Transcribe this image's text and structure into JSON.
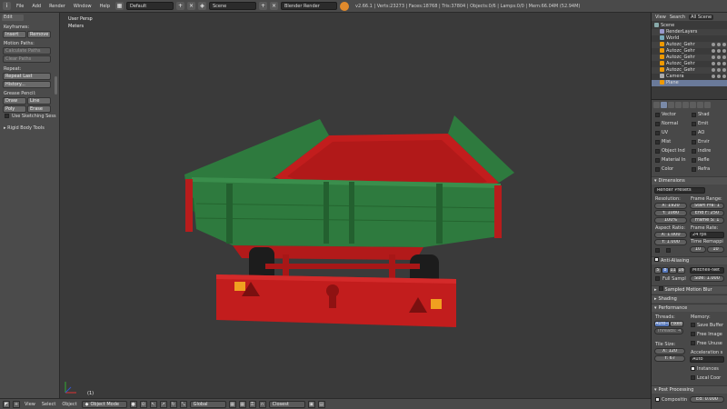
{
  "topbar": {
    "menus": [
      "File",
      "Add",
      "Render",
      "Window",
      "Help"
    ],
    "screen_layout": "Default",
    "scene": "Scene",
    "engine": "Blender Render",
    "stats": "v2.66.1 | Verts:23273 | Faces:18768 | Tris:37804 | Objects:0/6 | Lamps:0/0 | Mem:66.04M (52.94M)"
  },
  "toolshelf": {
    "tab": "Edit",
    "keyframes": {
      "title": "Keyframes:",
      "insert": "Insert",
      "remove": "Remove"
    },
    "motion_paths": {
      "title": "Motion Paths:",
      "calculate": "Calculate Paths",
      "clear": "Clear Paths"
    },
    "repeat": {
      "title": "Repeat:",
      "repeat_last": "Repeat Last",
      "history": "History..."
    },
    "grease_pencil": {
      "title": "Grease Pencil:",
      "draw": "Draw",
      "line": "Line",
      "poly": "Poly",
      "erase": "Erase",
      "sketching": "Use Sketching Sess"
    },
    "rigid_body": "Rigid Body Tools"
  },
  "viewport": {
    "view_name": "User Persp",
    "units": "Meters",
    "object_label": "(1)"
  },
  "bottombar": {
    "view": "View",
    "select": "Select",
    "object": "Object",
    "mode": "Object Mode",
    "pivot": "Global",
    "snap": "Closest"
  },
  "outliner": {
    "view": "View",
    "search": "Search",
    "filter": "All Scene",
    "rows": [
      {
        "name": "Scene"
      },
      {
        "name": "RenderLayers"
      },
      {
        "name": "World"
      },
      {
        "name": "Autozc_Gehr"
      },
      {
        "name": "Autozc_Gehr"
      },
      {
        "name": "Autozc_Gehr"
      },
      {
        "name": "Autozc_Gehr"
      },
      {
        "name": "Autozc_Gehr"
      },
      {
        "name": "Camera"
      },
      {
        "name": "Plane"
      }
    ]
  },
  "properties": {
    "passes_left": [
      "Vector",
      "Normal",
      "UV",
      "Mist",
      "Object Ind",
      "Material In",
      "Color"
    ],
    "passes_right": [
      "Shad",
      "Emit",
      "AO",
      "Envir",
      "Indire",
      "Refle",
      "Refra"
    ],
    "dimensions": {
      "title": "Dimensions",
      "preset": "Render Presets",
      "resolution": "Resolution:",
      "res_x": "X: 1920",
      "res_y": "Y: 1080",
      "res_pct": "100%",
      "frame_range": "Frame Range:",
      "start": "Start Fra: 1",
      "end": "End F: 250",
      "step": "Frame S: 1",
      "aspect": "Aspect Ratio:",
      "asp_x": "X: 1.000",
      "asp_y": "Y: 1.000",
      "frame_rate": "Frame Rate:",
      "fps": "24 fps",
      "time_remap": "Time Remappi",
      "old": "10",
      "new": "10"
    },
    "anti_aliasing": {
      "title": "Anti-Aliasing",
      "samples": [
        "5",
        "8",
        "11",
        "16"
      ],
      "filter": "Mitchell-Net",
      "full_sample": "Full Sampl",
      "size": "Size: 1.000"
    },
    "sampled_motion_blur": "Sampled Motion Blur",
    "shading": "Shading",
    "performance": {
      "title": "Performance",
      "threads": "Threads:",
      "auto_detect": "Auto-de",
      "fixed": "Fixed",
      "threads_val": "Threads: 4",
      "memory": "Memory:",
      "save_buffers": "Save Buffer",
      "free_image": "Free Image",
      "free_unused": "Free Unuse",
      "tile_size": "Tile Size:",
      "tile_x": "X: 120",
      "tile_y": "Y: 67",
      "acceleration": "Acceleration s",
      "accel_mode": "Auto",
      "instances": "Instances",
      "local_coords": "Local Coor"
    },
    "post_processing": {
      "title": "Post Processing",
      "compositing": "Compositin",
      "edge": "Ed: 0.000"
    }
  },
  "colors": {
    "trailer_green": "#2e7a3e",
    "trailer_red": "#c21d1d",
    "accent_blue": "#5577bb"
  }
}
